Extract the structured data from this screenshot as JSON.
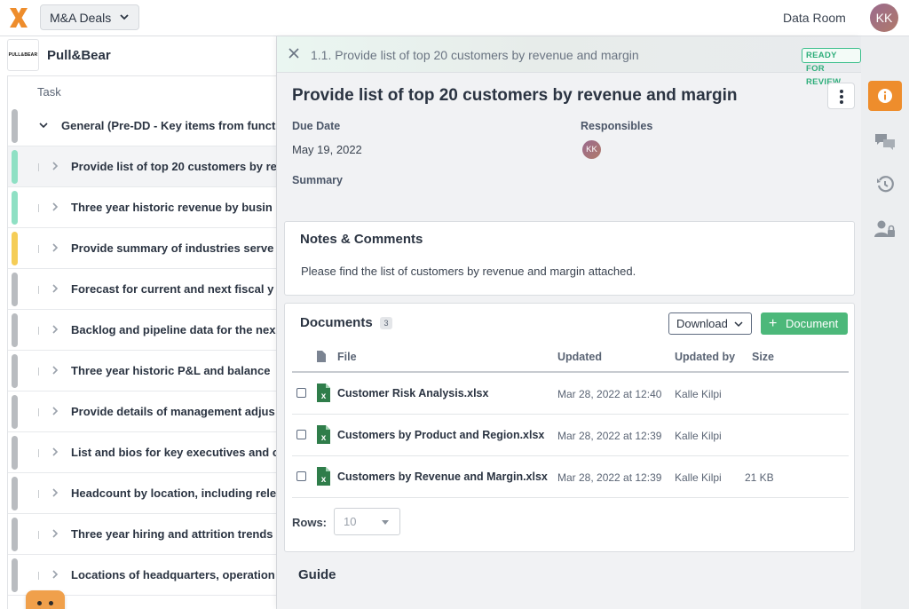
{
  "topbar": {
    "deal_selector": "M&A Deals",
    "data_room": "Data Room",
    "user_initials": "KK"
  },
  "project": {
    "logo_text": "PULL&BEAR",
    "name": "Pull&Bear"
  },
  "task_list": {
    "header": "Task",
    "rows": [
      {
        "label": "General (Pre-DD - Key items from funct",
        "color": "#b9bcc0",
        "group": true
      },
      {
        "label": "Provide list of top 20 customers by re",
        "color": "#8fe0c4",
        "selected": true
      },
      {
        "label": "Three year historic revenue by busin",
        "color": "#8fe0c4"
      },
      {
        "label": "Provide summary of industries serve",
        "color": "#f5cd57"
      },
      {
        "label": "Forecast for current and next fiscal y",
        "color": "#b9bcc0"
      },
      {
        "label": "Backlog and pipeline data for the nex",
        "color": "#b9bcc0"
      },
      {
        "label": "Three year historic P&L and balance",
        "color": "#b9bcc0"
      },
      {
        "label": "Provide details of management adjus",
        "color": "#b9bcc0"
      },
      {
        "label": "List and bios for key executives and c",
        "color": "#b9bcc0"
      },
      {
        "label": "Headcount by location, including rele",
        "color": "#b9bcc0"
      },
      {
        "label": "Three year hiring and attrition trends",
        "color": "#b9bcc0"
      },
      {
        "label": "Locations of headquarters, operation",
        "color": "#b9bcc0"
      }
    ]
  },
  "detail": {
    "breadcrumb": "1.1. Provide list of top 20 customers by revenue and margin",
    "status": "READY FOR REVIEW",
    "title": "Provide list of top 20 customers by revenue and margin",
    "due_date_label": "Due Date",
    "due_date": "May 19, 2022",
    "responsibles_label": "Responsibles",
    "responsible_initials": "KK",
    "summary_label": "Summary",
    "notes": {
      "title": "Notes & Comments",
      "text": "Please find the list of customers by revenue and margin attached."
    },
    "documents": {
      "title": "Documents",
      "count": "3",
      "download_label": "Download",
      "add_label": "Document",
      "columns": {
        "file": "File",
        "updated": "Updated",
        "updated_by": "Updated by",
        "size": "Size"
      },
      "files": [
        {
          "name": "Customer Risk Analysis.xlsx",
          "updated": "Mar 28, 2022 at 12:40",
          "by": "Kalle Kilpi",
          "size": ""
        },
        {
          "name": "Customers by Product and Region.xlsx",
          "updated": "Mar 28, 2022 at 12:39",
          "by": "Kalle Kilpi",
          "size": ""
        },
        {
          "name": "Customers by Revenue and Margin.xlsx",
          "updated": "Mar 28, 2022 at 12:39",
          "by": "Kalle Kilpi",
          "size": "21 KB"
        }
      ],
      "rows_label": "Rows:",
      "rows_value": "10"
    },
    "guide_title": "Guide"
  },
  "colors": {
    "accent_orange": "#ee8d2c",
    "success_green": "#4cb87a",
    "status_green": "#2fae7b"
  }
}
